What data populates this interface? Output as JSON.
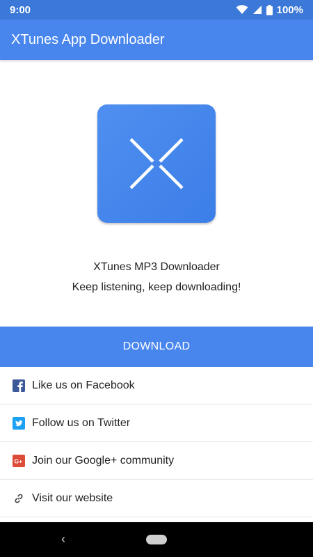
{
  "status_bar": {
    "time": "9:00",
    "battery": "100%"
  },
  "app_bar": {
    "title": "XTunes App Downloader"
  },
  "app_info": {
    "name": "XTunes MP3 Downloader",
    "tagline": "Keep listening, keep downloading!"
  },
  "actions": {
    "download_label": "DOWNLOAD"
  },
  "links": [
    {
      "label": "Like us on Facebook",
      "icon": "facebook-icon"
    },
    {
      "label": "Follow us on Twitter",
      "icon": "twitter-icon"
    },
    {
      "label": "Join our Google+ community",
      "icon": "google-plus-icon"
    },
    {
      "label": "Visit our website",
      "icon": "link-icon"
    }
  ],
  "colors": {
    "primary": "#4886ee",
    "status_bar": "#3b78d8",
    "nav_bar": "#000000"
  }
}
